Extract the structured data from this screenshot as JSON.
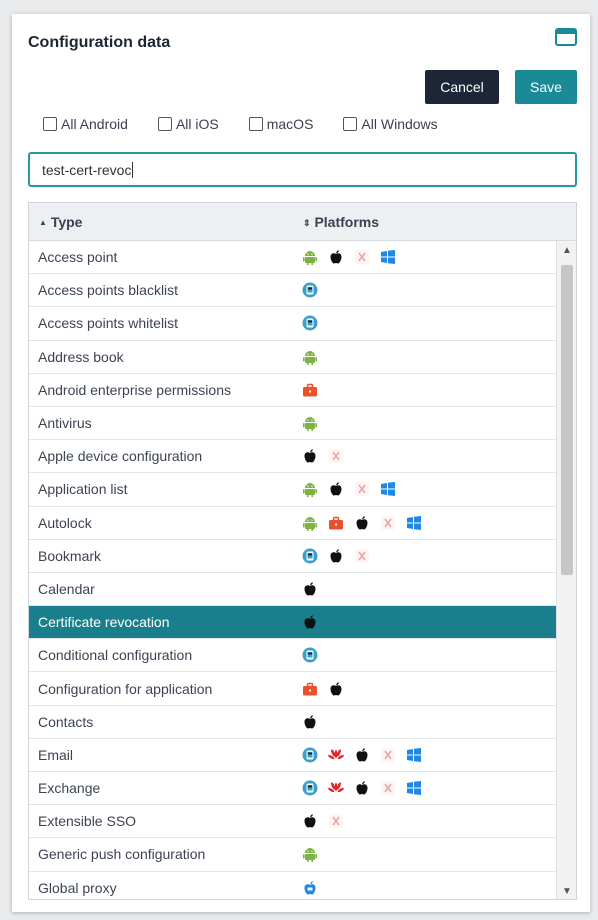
{
  "dialog": {
    "title": "Configuration data",
    "cancel_label": "Cancel",
    "save_label": "Save"
  },
  "filters": [
    {
      "label": "All Android",
      "checked": false
    },
    {
      "label": "All iOS",
      "checked": false
    },
    {
      "label": "macOS",
      "checked": false
    },
    {
      "label": "All Windows",
      "checked": false
    }
  ],
  "search": {
    "value": "test-cert-revoc"
  },
  "table": {
    "col_type": "Type",
    "col_platforms": "Platforms",
    "rows": [
      {
        "label": "Access point",
        "platforms": [
          "android",
          "apple",
          "x",
          "windows"
        ]
      },
      {
        "label": "Access points blacklist",
        "platforms": [
          "ios-device"
        ]
      },
      {
        "label": "Access points whitelist",
        "platforms": [
          "ios-device"
        ]
      },
      {
        "label": "Address book",
        "platforms": [
          "android"
        ]
      },
      {
        "label": "Android enterprise permissions",
        "platforms": [
          "briefcase"
        ]
      },
      {
        "label": "Antivirus",
        "platforms": [
          "android"
        ]
      },
      {
        "label": "Apple device configuration",
        "platforms": [
          "apple",
          "x"
        ]
      },
      {
        "label": "Application list",
        "platforms": [
          "android",
          "apple",
          "x",
          "windows"
        ]
      },
      {
        "label": "Autolock",
        "platforms": [
          "android",
          "briefcase",
          "apple",
          "x",
          "windows"
        ]
      },
      {
        "label": "Bookmark",
        "platforms": [
          "ios-device",
          "apple",
          "x"
        ]
      },
      {
        "label": "Calendar",
        "platforms": [
          "apple"
        ]
      },
      {
        "label": "Certificate revocation",
        "platforms": [
          "apple"
        ],
        "selected": true
      },
      {
        "label": "Conditional configuration",
        "platforms": [
          "ios-device"
        ]
      },
      {
        "label": "Configuration for application",
        "platforms": [
          "briefcase",
          "apple"
        ]
      },
      {
        "label": "Contacts",
        "platforms": [
          "apple"
        ]
      },
      {
        "label": "Email",
        "platforms": [
          "ios-device",
          "huawei",
          "apple",
          "x",
          "windows"
        ]
      },
      {
        "label": "Exchange",
        "platforms": [
          "ios-device",
          "huawei",
          "apple",
          "x",
          "windows"
        ]
      },
      {
        "label": "Extensible SSO",
        "platforms": [
          "apple",
          "x"
        ]
      },
      {
        "label": "Generic push configuration",
        "platforms": [
          "android"
        ]
      },
      {
        "label": "Global proxy",
        "platforms": [
          "ios-blue"
        ]
      }
    ]
  },
  "colors": {
    "accent": "#1a8a96",
    "selected_row": "#1a7f8c",
    "cancel_button": "#1d2636",
    "android": "#7cb342",
    "briefcase": "#e8512a",
    "windows": "#1e88e5",
    "huawei": "#e5252a"
  }
}
